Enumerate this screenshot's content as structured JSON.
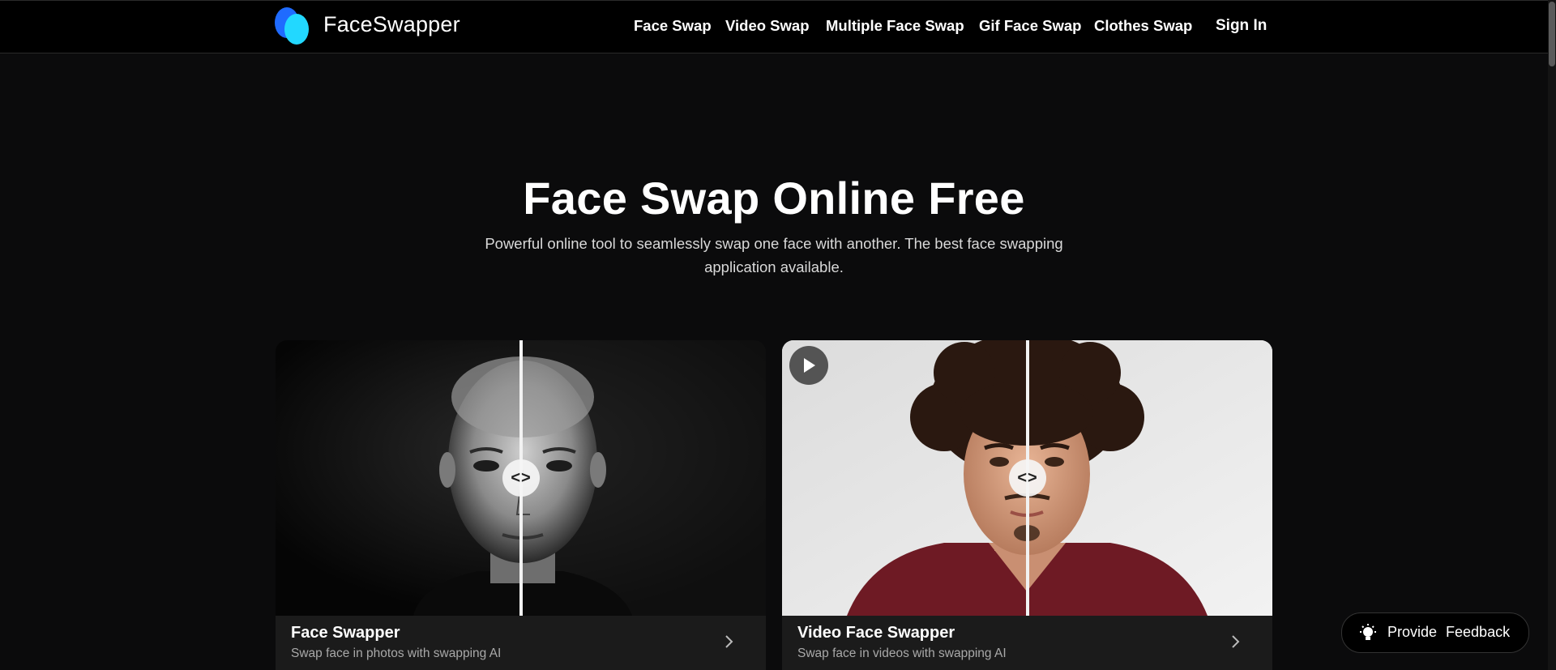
{
  "header": {
    "brand": "FaceSwapper",
    "nav": [
      {
        "label": "Face Swap"
      },
      {
        "label": "Video Swap"
      },
      {
        "label": "Multiple Face Swap"
      },
      {
        "label": "Gif Face Swap"
      },
      {
        "label": "Clothes Swap"
      }
    ],
    "sign_in": "Sign In"
  },
  "hero": {
    "title": "Face Swap Online Free",
    "subtitle": "Powerful online tool to seamlessly swap one face with another. The best face swapping application available."
  },
  "cards": [
    {
      "title": "Face Swapper",
      "description": "Swap face in photos with swapping AI",
      "handle_glyph": "<>"
    },
    {
      "title": "Video Face Swapper",
      "description": "Swap face in videos with swapping AI",
      "handle_glyph": "<>"
    }
  ],
  "feedback": {
    "label": "Provide Feedback"
  },
  "colors": {
    "background": "#0b0b0c",
    "header": "#000000",
    "logo_blue": "#1f6bff",
    "logo_cyan": "#22d8ff"
  },
  "icons": [
    "logo-icon",
    "compare-handle-icon",
    "play-icon",
    "chevron-right-icon",
    "lightbulb-icon"
  ]
}
